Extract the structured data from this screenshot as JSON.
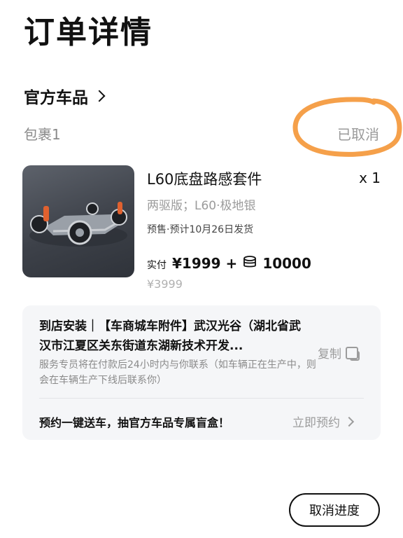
{
  "page": {
    "title": "订单详情"
  },
  "store": {
    "name": "官方车品"
  },
  "package": {
    "label": "包裹1",
    "status": "已取消"
  },
  "product": {
    "name": "L60底盘路感套件",
    "quantity": "x 1",
    "variant": "两驱版；L60·极地银",
    "presale": "预售·预计10月26日发货",
    "paid_label": "实付",
    "paid_amount": "¥1999 +",
    "points": "10000",
    "original_price": "¥3999",
    "thumbnail_icon": "chassis-image"
  },
  "install": {
    "address": "到店安装｜【车商城车附件】武汉光谷（湖北省武汉市江夏区关东街道东湖新技术开发...",
    "copy_label": "复制",
    "service_note": "服务专员将在付款后24小时内与你联系（如车辆正在生产中，则会在车辆生产下线后联系你）",
    "promo": "预约一键送车，抽官方车品专属盲盒！",
    "reserve_label": "立即预约"
  },
  "actions": {
    "cancel_progress": "取消进度"
  },
  "colors": {
    "annotation": "#f5a04a",
    "muted": "#9c9c9c",
    "card_bg": "#f5f6f8"
  }
}
